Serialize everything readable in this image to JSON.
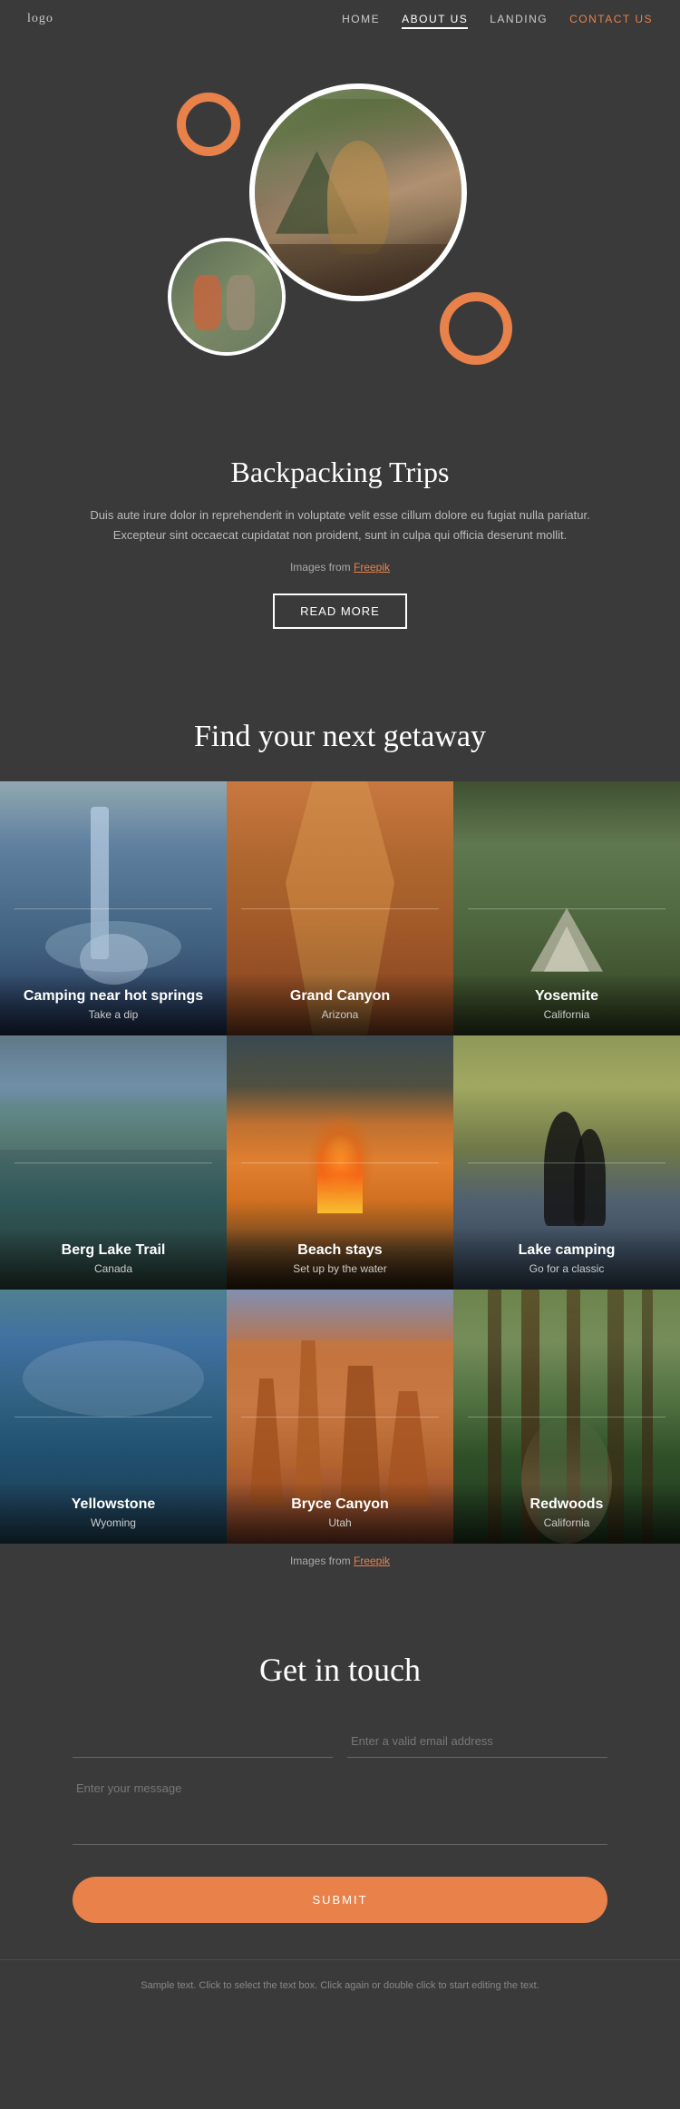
{
  "nav": {
    "logo": "logo",
    "links": [
      {
        "label": "HOME",
        "href": "#",
        "active": false
      },
      {
        "label": "ABOUT US",
        "href": "#",
        "active": true
      },
      {
        "label": "LANDING",
        "href": "#",
        "active": false
      },
      {
        "label": "CONTACT US",
        "href": "#",
        "active": false,
        "highlight": true
      }
    ]
  },
  "hero": {
    "alt_main": "Person sitting by campfire in autumn",
    "alt_small": "Two people camping selfie"
  },
  "backpacking": {
    "title": "Backpacking Trips",
    "description": "Duis aute irure dolor in reprehenderit in voluptate velit esse cillum dolore eu fugiat nulla pariatur. Excepteur sint occaecat cupidatat non proident, sunt in culpa qui officia deserunt mollit.",
    "images_credit": "Images from",
    "images_link_text": "Freepik",
    "read_more": "READ MORE"
  },
  "getaway": {
    "title": "Find your next getaway",
    "grid": [
      {
        "title": "Camping near hot springs",
        "subtitle": "Take a dip",
        "bg": "hot-springs"
      },
      {
        "title": "Grand Canyon",
        "subtitle": "Arizona",
        "bg": "grand-canyon"
      },
      {
        "title": "Yosemite",
        "subtitle": "California",
        "bg": "yosemite"
      },
      {
        "title": "Berg Lake Trail",
        "subtitle": "Canada",
        "bg": "berg-lake"
      },
      {
        "title": "Beach stays",
        "subtitle": "Set up by the water",
        "bg": "beach-stays"
      },
      {
        "title": "Lake camping",
        "subtitle": "Go for a classic",
        "bg": "lake-camping"
      },
      {
        "title": "Yellowstone",
        "subtitle": "Wyoming",
        "bg": "yellowstone"
      },
      {
        "title": "Bryce Canyon",
        "subtitle": "Utah",
        "bg": "bryce-canyon"
      },
      {
        "title": "Redwoods",
        "subtitle": "California",
        "bg": "redwoods"
      }
    ],
    "images_credit": "Images from",
    "images_link_text": "Freepik"
  },
  "contact": {
    "title": "Get in touch",
    "name_placeholder": "",
    "email_placeholder": "Enter a valid email address",
    "message_placeholder": "Enter your message",
    "submit_label": "SUBMIT"
  },
  "footer": {
    "note": "Sample text. Click to select the text box. Click again or double click to start editing the text."
  }
}
